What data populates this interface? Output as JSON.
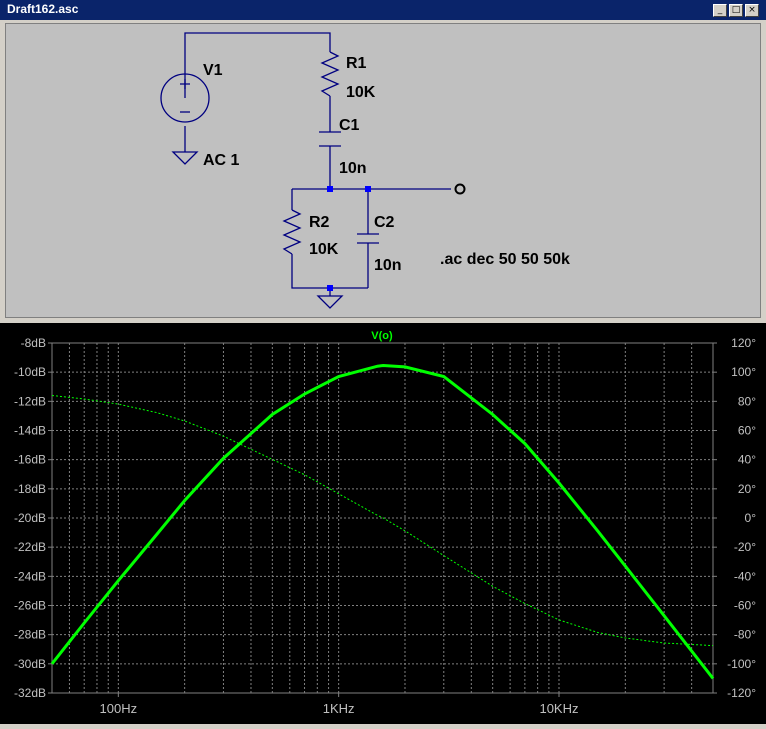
{
  "window": {
    "title": "Draft162.asc",
    "buttons": {
      "minimize": "_",
      "maximize": "□",
      "close": "×"
    }
  },
  "schematic": {
    "components": {
      "v1_name": "V1",
      "v1_value": "AC 1",
      "r1_name": "R1",
      "r1_value": "10K",
      "c1_name": "C1",
      "c1_value": "10n",
      "r2_name": "R2",
      "r2_value": "10K",
      "c2_name": "C2",
      "c2_value": "10n"
    },
    "output_node_label": "o",
    "directive": ".ac dec 50 50 50k"
  },
  "plot": {
    "trace_label": "V(o)",
    "colors": {
      "trace": "#00ff00",
      "grid": "#808080",
      "axis_text": "#c0c0c0",
      "background": "#000000"
    },
    "left_ticks": [
      "-8dB",
      "-10dB",
      "-12dB",
      "-14dB",
      "-16dB",
      "-18dB",
      "-20dB",
      "-22dB",
      "-24dB",
      "-26dB",
      "-28dB",
      "-30dB",
      "-32dB"
    ],
    "right_ticks": [
      "120°",
      "100°",
      "80°",
      "60°",
      "40°",
      "20°",
      "0°",
      "-20°",
      "-40°",
      "-60°",
      "-80°",
      "-100°",
      "-120°"
    ],
    "x_ticks": [
      "100Hz",
      "1KHz",
      "10KHz"
    ]
  },
  "chart_data": {
    "type": "line",
    "title": "V(o)",
    "x_scale": "log",
    "xlim": [
      50,
      50000
    ],
    "ylim_left": [
      -32,
      -8
    ],
    "ylim_right": [
      -120,
      120
    ],
    "grid": true,
    "series": [
      {
        "name": "V(o)",
        "style": "solid",
        "axis": "left-dB",
        "x": [
          50,
          70,
          100,
          150,
          200,
          300,
          500,
          700,
          1000,
          1500,
          1592,
          2000,
          3000,
          5000,
          7000,
          10000,
          15000,
          20000,
          30000,
          50000
        ],
        "y": [
          -30.0,
          -27.2,
          -24.3,
          -21.1,
          -18.8,
          -15.9,
          -12.9,
          -11.5,
          -10.3,
          -9.59,
          -9.54,
          -9.64,
          -10.3,
          -12.9,
          -14.9,
          -17.6,
          -20.9,
          -23.3,
          -26.7,
          -31.0
        ]
      },
      {
        "name": "phase",
        "style": "dashed",
        "axis": "right-deg",
        "x": [
          50,
          70,
          100,
          150,
          200,
          300,
          500,
          700,
          1000,
          1500,
          1592,
          2000,
          3000,
          5000,
          7000,
          10000,
          15000,
          20000,
          30000,
          50000
        ],
        "y": [
          84.0,
          81.6,
          78.1,
          72.2,
          66.5,
          56.1,
          40.2,
          29.7,
          16.6,
          1.8,
          0,
          -8.8,
          -25.8,
          -46.8,
          -58.6,
          -69.9,
          -78.5,
          -82.3,
          -85.7,
          -87.5
        ]
      }
    ]
  }
}
